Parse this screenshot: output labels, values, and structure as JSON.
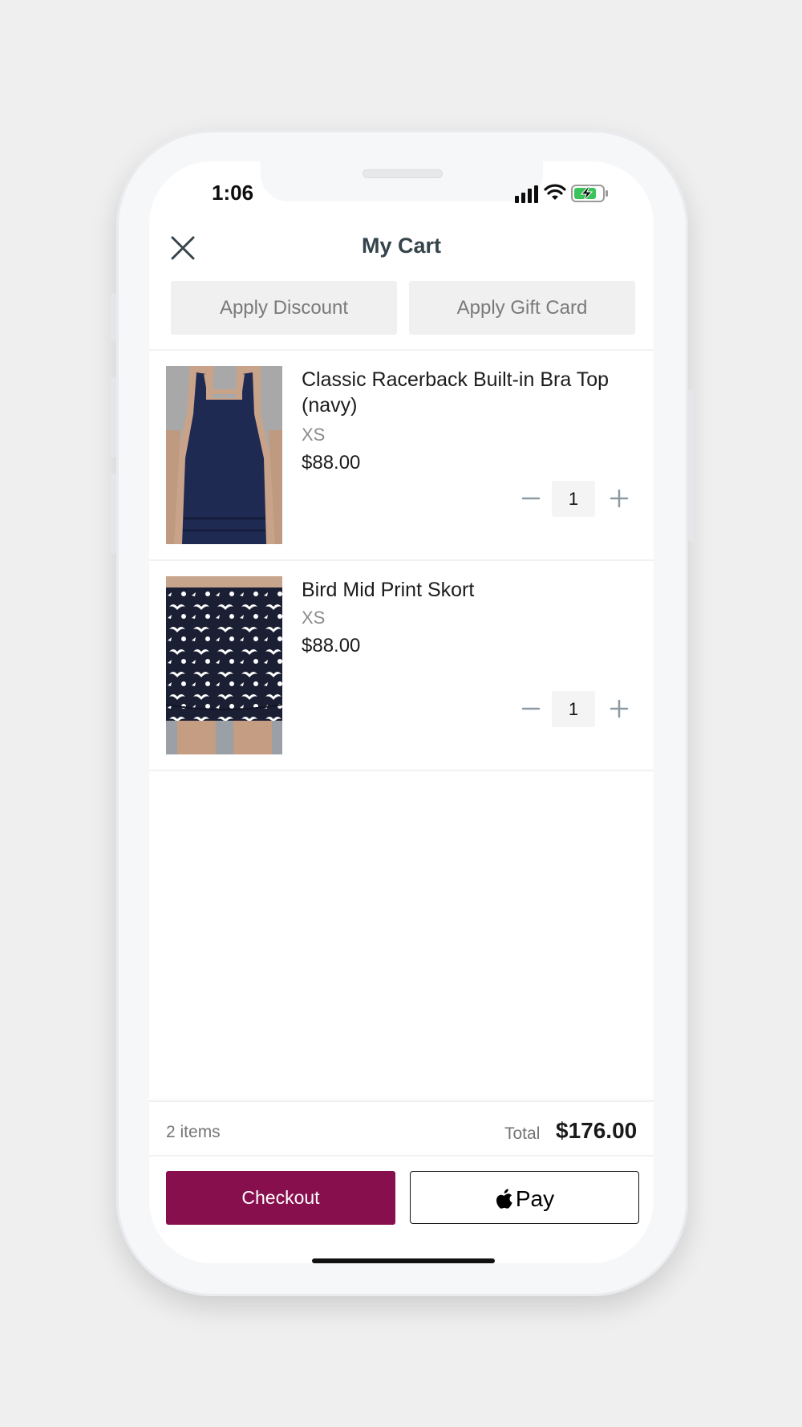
{
  "status_bar": {
    "time": "1:06"
  },
  "header": {
    "title": "My Cart",
    "close_icon": "close-icon"
  },
  "actions": {
    "apply_discount": "Apply Discount",
    "apply_gift_card": "Apply Gift Card"
  },
  "items": [
    {
      "name": "Classic Racerback Built-in Bra Top (navy)",
      "size": "XS",
      "price": "$88.00",
      "quantity": "1"
    },
    {
      "name": "Bird Mid Print Skort",
      "size": "XS",
      "price": "$88.00",
      "quantity": "1"
    }
  ],
  "summary": {
    "items_count": "2 items",
    "total_label": "Total",
    "total_value": "$176.00"
  },
  "buttons": {
    "checkout": "Checkout",
    "apple_pay": "Pay"
  },
  "colors": {
    "accent": "#880f4d",
    "title": "#35444b",
    "product_navy": "#1f2a52"
  }
}
